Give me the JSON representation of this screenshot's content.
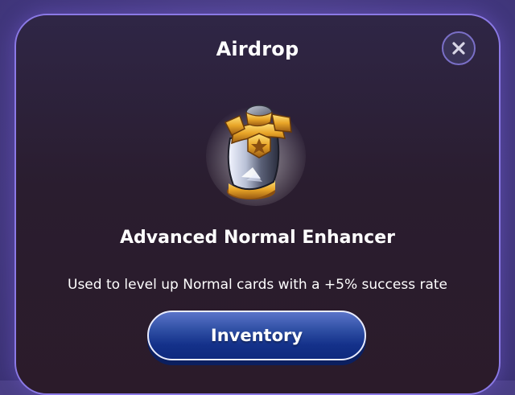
{
  "modal": {
    "title": "Airdrop",
    "close_icon": "close-icon"
  },
  "item": {
    "icon": "enhancer-icon",
    "name": "Advanced Normal Enhancer",
    "description": "Used to level up Normal cards with a +5% success rate"
  },
  "actions": {
    "inventory_label": "Inventory"
  },
  "colors": {
    "backdrop": "#4a3f86",
    "modal_border": "#8b79e6",
    "button_primary": "#14318a",
    "text": "#ffffff"
  }
}
